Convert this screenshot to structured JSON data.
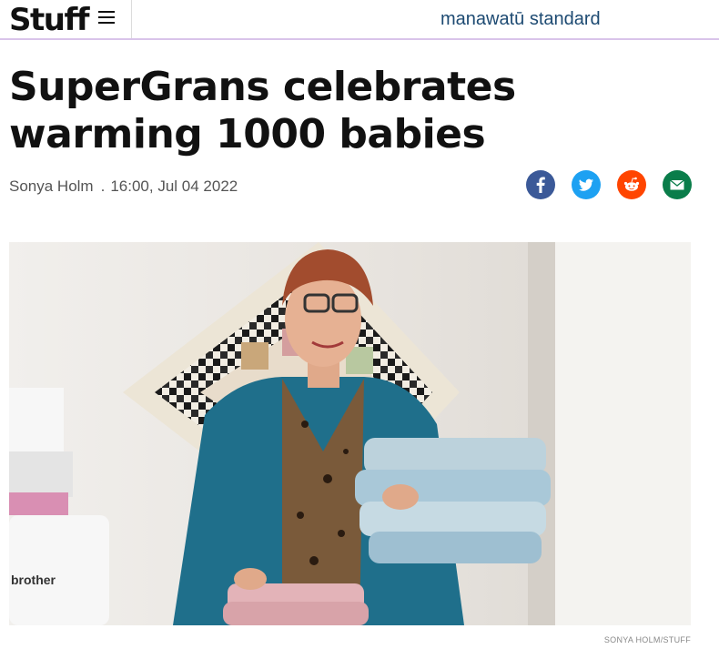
{
  "header": {
    "logo": "Stuff",
    "masthead": "manawatū standard"
  },
  "article": {
    "headline": "SuperGrans celebrates warming 1000 babies",
    "author": "Sonya Holm",
    "separator": ".",
    "timestamp": "16:00, Jul 04 2022"
  },
  "share": {
    "icons": [
      "facebook-icon",
      "twitter-icon",
      "reddit-icon",
      "email-icon"
    ],
    "colors": {
      "facebook": "#3b5998",
      "twitter": "#1da1f2",
      "reddit": "#ff4500",
      "email": "#0a7d4a"
    }
  },
  "image": {
    "credit": "SONYA HOLM/STUFF",
    "machine_brand": "brother"
  },
  "colors": {
    "masthead": "#1d4a72",
    "header_border": "#d9c4ea"
  }
}
